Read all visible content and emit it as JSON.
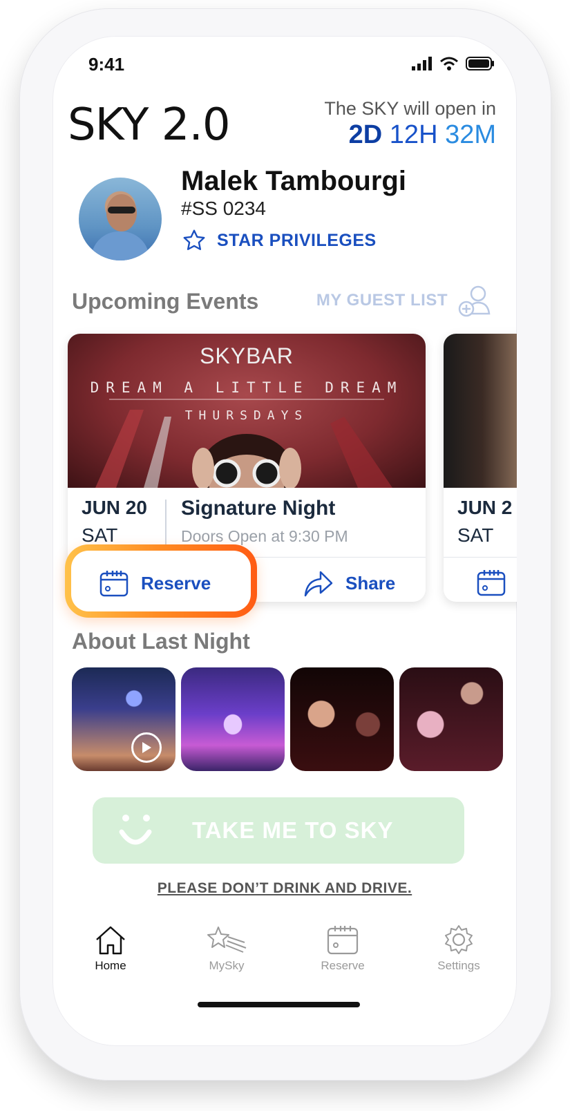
{
  "status_bar": {
    "time": "9:41"
  },
  "header": {
    "logo": "SKY 2.0",
    "open_label": "The SKY will open in",
    "countdown": {
      "days": "2D",
      "hours": "12H",
      "minutes": "32M"
    }
  },
  "profile": {
    "name": "Malek Tambourgi",
    "member_id": "#SS 0234",
    "privileges_label": "STAR PRIVILEGES"
  },
  "upcoming": {
    "title": "Upcoming Events",
    "guest_list_label": "MY GUEST LIST",
    "events": [
      {
        "brand": "SKYBAR",
        "tagline": "DREAM A LITTLE DREAM",
        "subtitle": "THURSDAYS",
        "date": "JUN 20",
        "day": "SAT",
        "title": "Signature Night",
        "doors": "Doors Open at 9:30 PM",
        "reserve_label": "Reserve",
        "share_label": "Share"
      },
      {
        "date": "JUN 2",
        "day": "SAT"
      }
    ]
  },
  "last_night": {
    "title": "About Last Night"
  },
  "cta": {
    "label": "TAKE ME TO SKY"
  },
  "notice": "PLEASE DON’T DRINK AND DRIVE.",
  "tabs": [
    {
      "label": "Home",
      "icon": "home-icon",
      "active": true
    },
    {
      "label": "MySky",
      "icon": "shooting-star-icon"
    },
    {
      "label": "Reserve",
      "icon": "calendar-icon"
    },
    {
      "label": "Settings",
      "icon": "gear-icon"
    }
  ],
  "colors": {
    "accent": "#1a4fbf",
    "highlight": "#ff8a22",
    "cta_bg": "#d7f0d9"
  }
}
